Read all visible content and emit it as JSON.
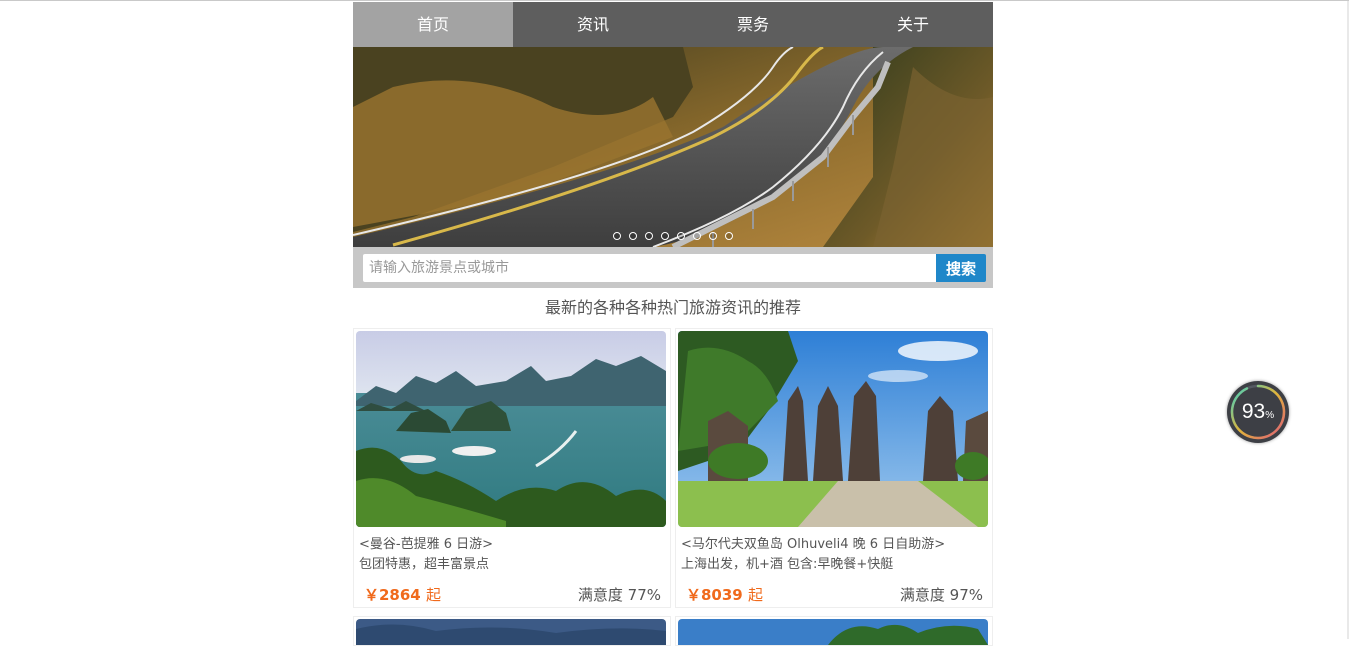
{
  "nav": {
    "items": [
      {
        "label": "首页",
        "active": true
      },
      {
        "label": "资讯",
        "active": false
      },
      {
        "label": "票务",
        "active": false
      },
      {
        "label": "关于",
        "active": false
      }
    ]
  },
  "banner": {
    "image": "winding road through autumn forest",
    "slide_count": 8,
    "active_slide": 0
  },
  "search": {
    "placeholder": "请输入旅游景点或城市",
    "value": "",
    "button_label": "搜索"
  },
  "section_title": "最新的各种各种热门旅游资讯的推荐",
  "cards": [
    {
      "image": "bay with limestone islands and boats",
      "title": "<曼谷-芭提雅 6 日游>",
      "subtitle": "包团特惠，超丰富景点",
      "price": "￥2864",
      "price_suffix": "起",
      "satisfaction": "满意度 77%"
    },
    {
      "image": "Balinese temple gates under blue sky",
      "title": "<马尔代夫双鱼岛 Olhuveli4 晚 6 日自助游>",
      "subtitle": "上海出发，机+酒 包含:早晚餐+快艇",
      "price": "￥8039",
      "price_suffix": "起",
      "satisfaction": "满意度 97%"
    }
  ],
  "gauge": {
    "value": "93",
    "unit": "%",
    "fraction": 0.93
  },
  "colors": {
    "nav_bg": "#5e5e5e",
    "nav_active": "#a3a3a3",
    "search_button": "#1f87c9",
    "price": "#f06a1c"
  }
}
